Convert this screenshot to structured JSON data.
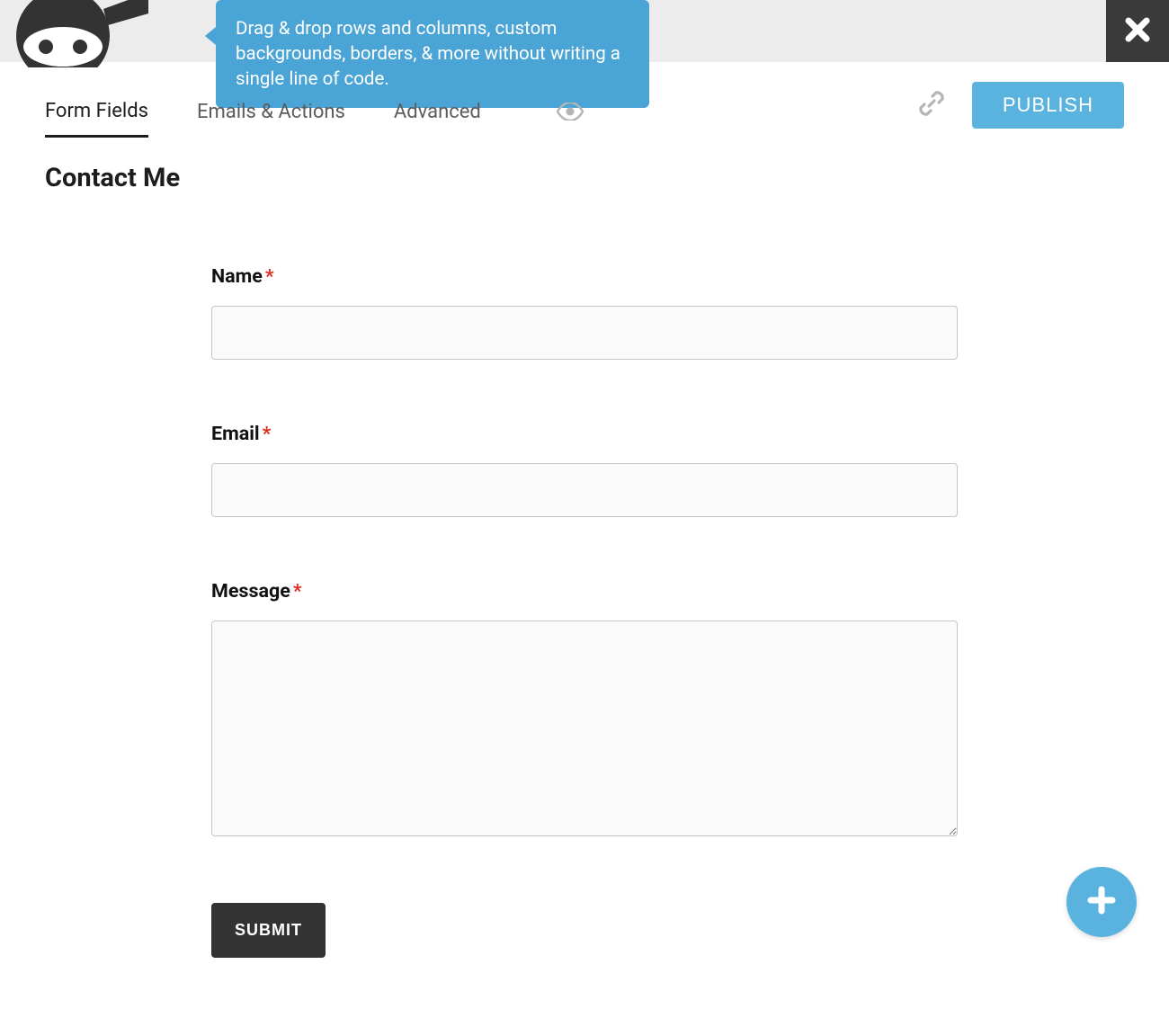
{
  "tooltip": "Drag & drop rows and columns, custom backgrounds, borders, & more without writing a single line of code.",
  "tabs": {
    "form_fields": "Form Fields",
    "emails_actions": "Emails & Actions",
    "advanced": "Advanced"
  },
  "publish_label": "PUBLISH",
  "form_title": "Contact Me",
  "fields": {
    "name": {
      "label": "Name",
      "required": "*",
      "value": ""
    },
    "email": {
      "label": "Email",
      "required": "*",
      "value": ""
    },
    "message": {
      "label": "Message",
      "required": "*",
      "value": ""
    }
  },
  "submit_label": "SUBMIT"
}
